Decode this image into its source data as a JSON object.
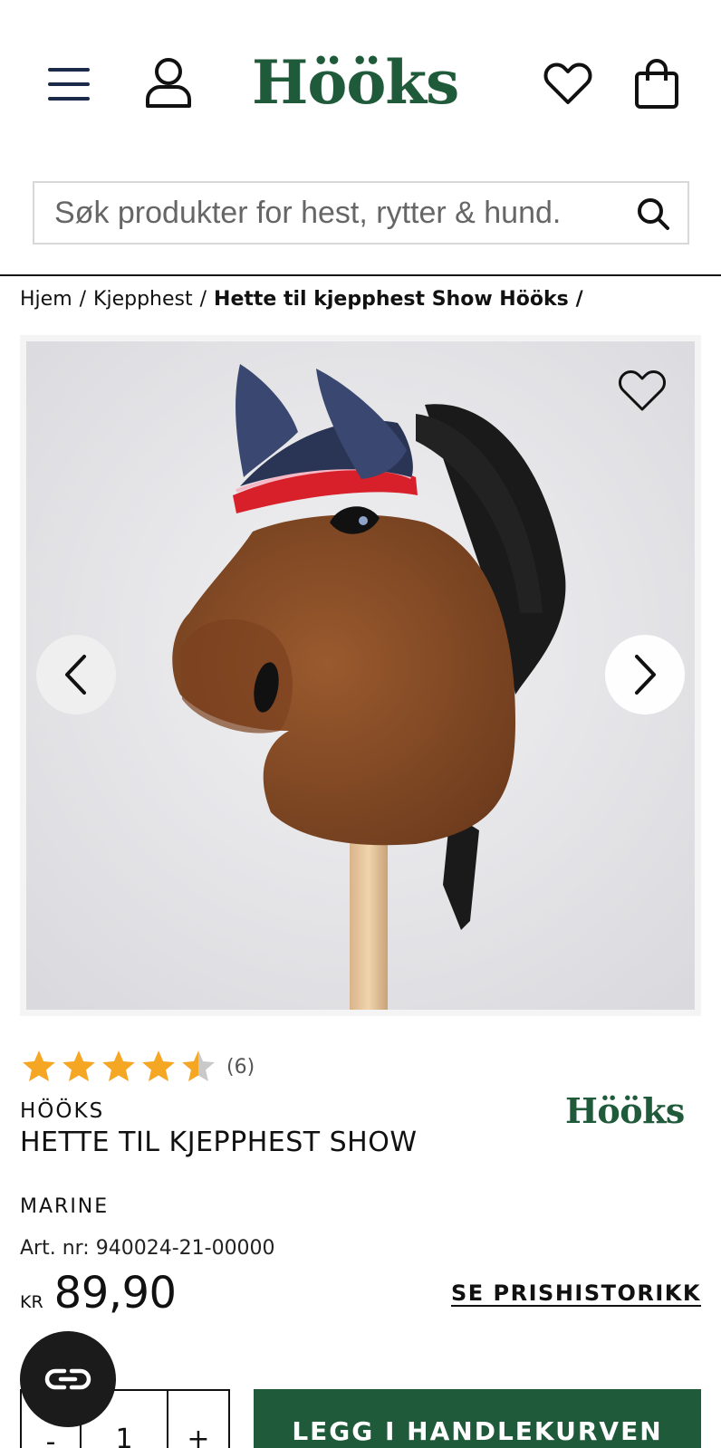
{
  "header": {
    "logo_text": "Hööks",
    "menu_icon": "hamburger-menu-icon",
    "account_icon": "user-icon",
    "wishlist_icon": "heart-icon",
    "cart_icon": "shopping-bag-icon"
  },
  "search": {
    "placeholder": "Søk produkter for hest, rytter & hund.",
    "value": "",
    "icon": "search-icon"
  },
  "breadcrumb": {
    "items": [
      "Hjem",
      "Kjepphest",
      "Hette til kjepphest Show Hööks"
    ],
    "separator": "/"
  },
  "gallery": {
    "prev_icon": "chevron-left-icon",
    "next_icon": "chevron-right-icon",
    "wishlist_icon": "heart-outline-icon"
  },
  "rating": {
    "stars": 4.5,
    "max": 5,
    "count_text": "(6)"
  },
  "product": {
    "brand": "HÖÖKS",
    "name": "HETTE TIL KJEPPHEST SHOW",
    "brand_logo_text": "Hööks",
    "color": "MARINE",
    "article_number": "Art. nr: 940024-21-00000",
    "currency": "KR",
    "price": "89,90",
    "price_history_link": "SE PRISHISTORIKK"
  },
  "purchase": {
    "minus_label": "-",
    "quantity": "1",
    "plus_label": "+",
    "add_to_cart_label": "LEGG I HANDLEKURVEN"
  },
  "chat": {
    "icon": "chat-widget-icon"
  },
  "colors": {
    "brand_green": "#1f5a3a",
    "star": "#f5a623",
    "navy": "#1c2a4a"
  }
}
